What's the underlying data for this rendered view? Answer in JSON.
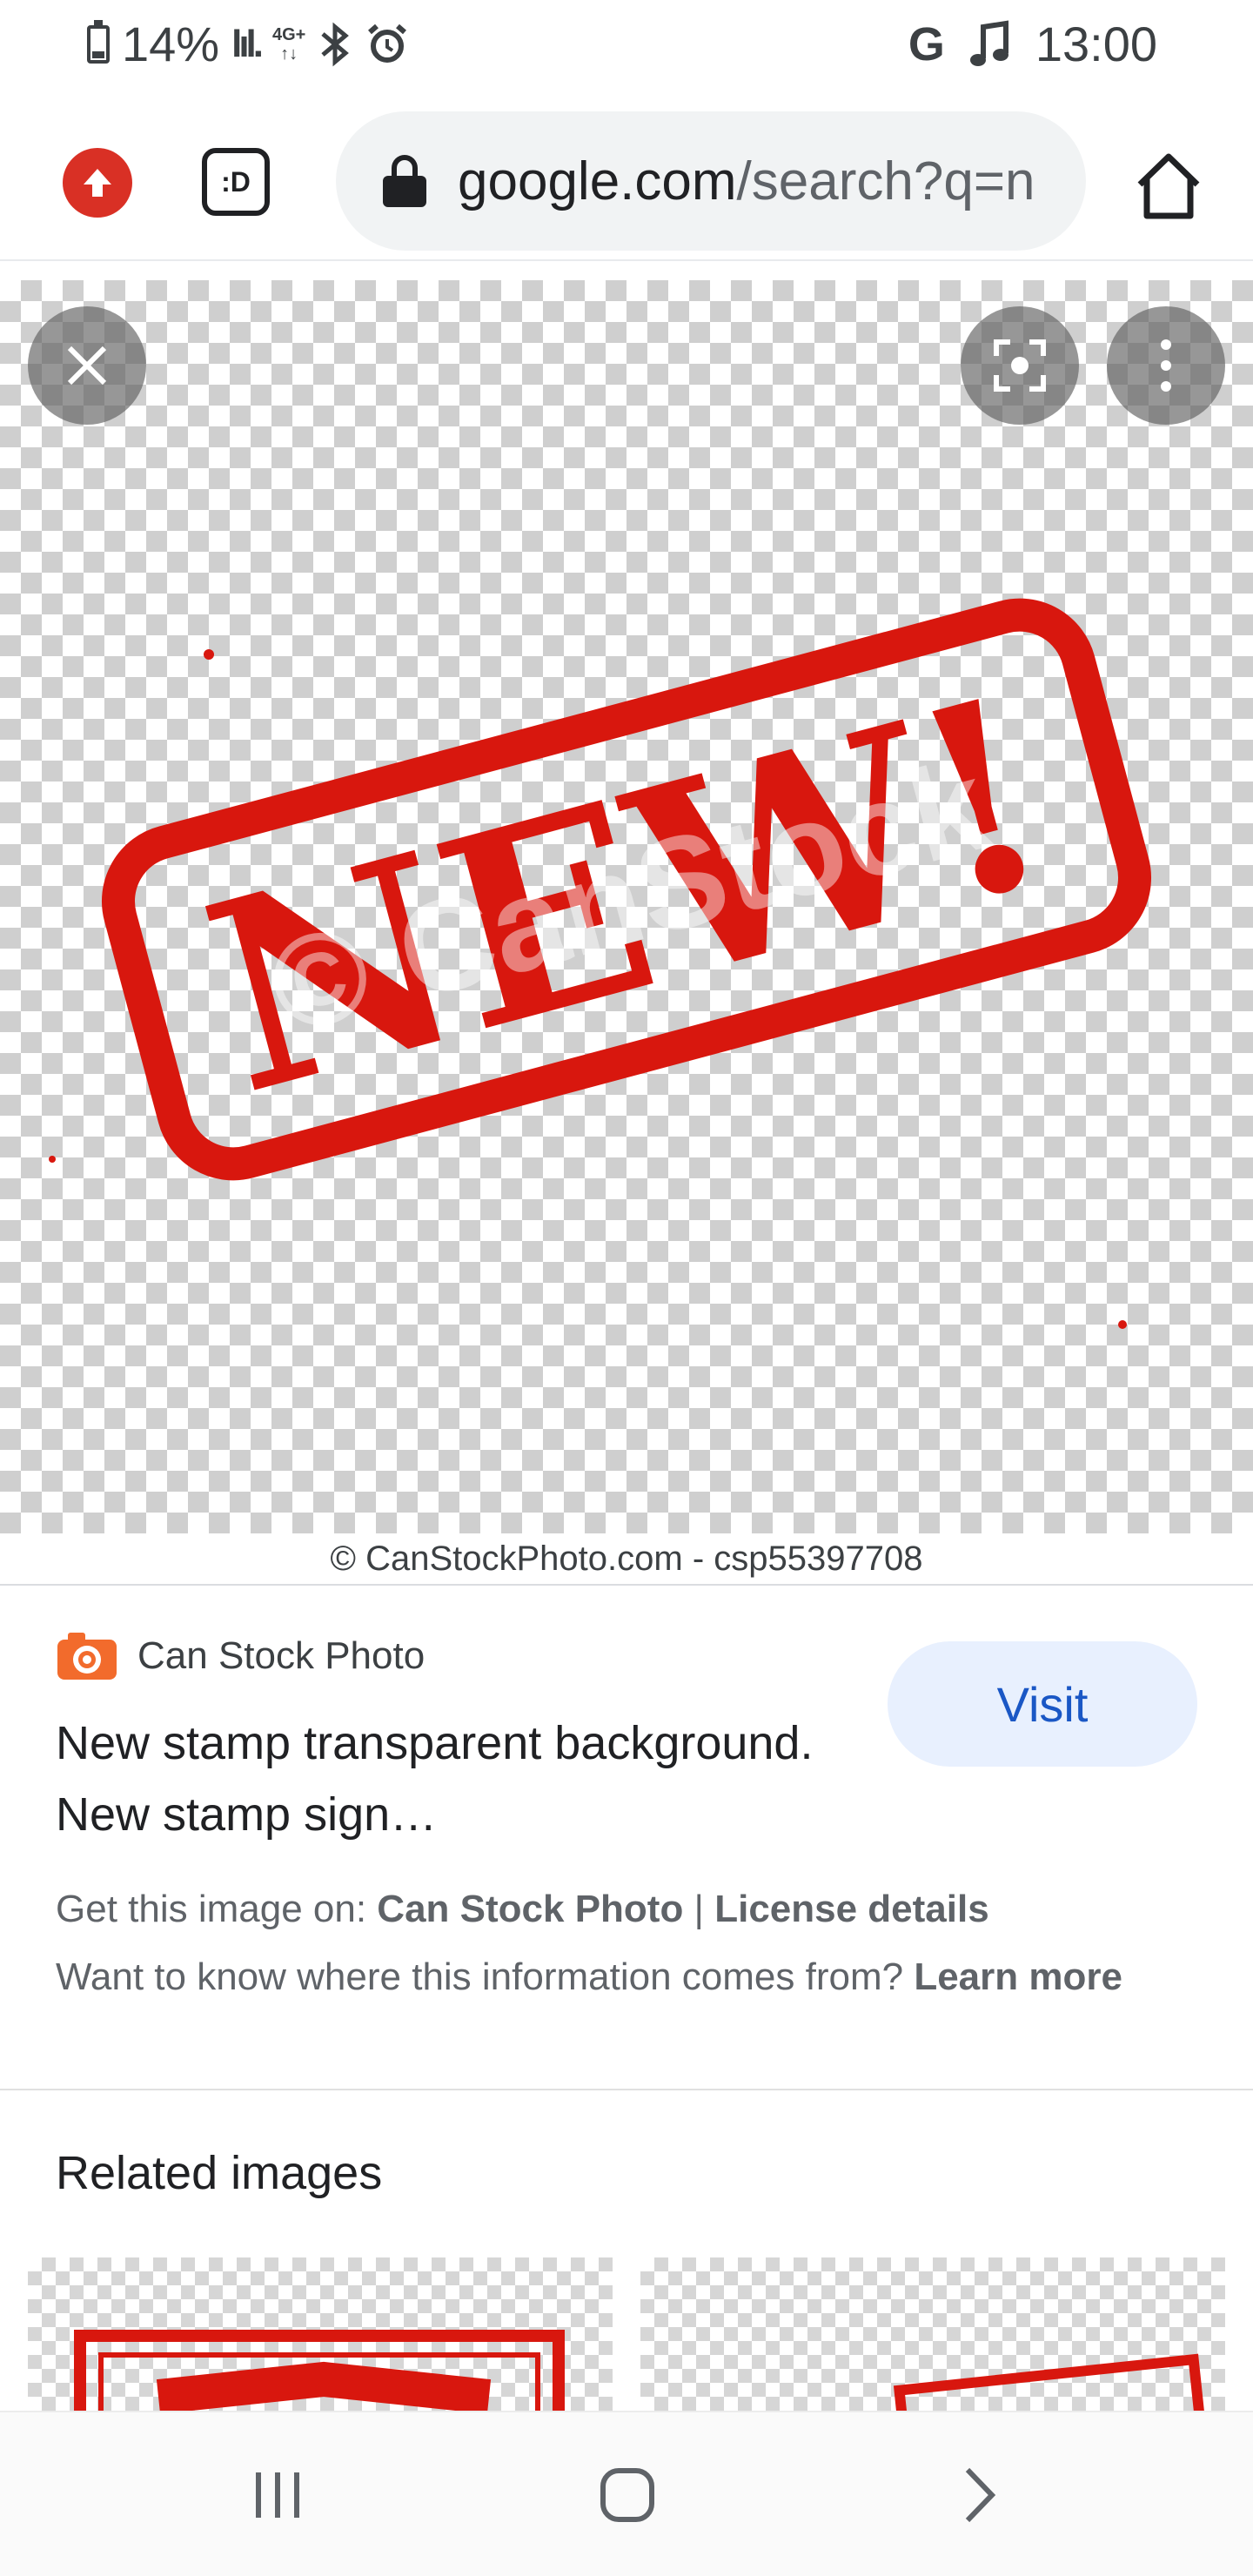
{
  "status_bar": {
    "battery": "14%",
    "network": "4G+",
    "carrier_icon": "G",
    "time": "13:00",
    "icons": [
      "battery-icon",
      "signal-icon",
      "network-4g-icon",
      "bluetooth-icon",
      "alarm-icon",
      "google-icon",
      "music-note-icon"
    ]
  },
  "browser": {
    "tab_icon_label": ":D",
    "url_host": "google.com",
    "url_path": "/search?q=n",
    "icons": [
      "upload-icon",
      "tab-switcher-icon",
      "lock-icon",
      "home-icon"
    ]
  },
  "viewer": {
    "stamp_text": "NEW!",
    "watermark_text": "© CanStock",
    "credit": "© CanStockPhoto.com - csp55397708",
    "icons": [
      "close-icon",
      "lens-icon",
      "more-vert-icon"
    ],
    "colors": {
      "stamp_red": "#d8170e"
    }
  },
  "source": {
    "site_name": "Can Stock Photo",
    "visit_label": "Visit",
    "title": "New stamp transparent background. New stamp sign…",
    "get_image_prefix": "Get this image on: ",
    "get_image_site": "Can Stock Photo",
    "separator": " | ",
    "license_label": "License details",
    "info_question": "Want to know where this information comes from? ",
    "learn_more": "Learn more"
  },
  "related": {
    "title": "Related images"
  },
  "nav": {
    "icons": [
      "recents-icon",
      "home-icon",
      "back-icon"
    ]
  }
}
